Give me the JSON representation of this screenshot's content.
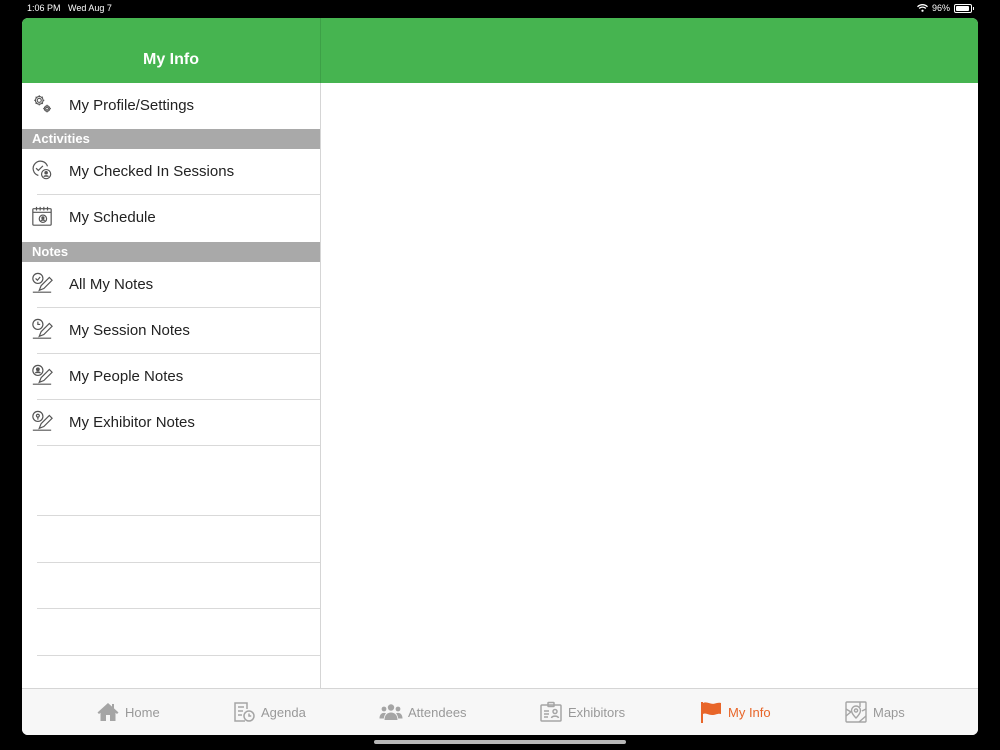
{
  "status": {
    "time": "1:06 PM",
    "date": "Wed Aug 7",
    "battery": "96%",
    "battery_level": 0.96
  },
  "header": {
    "title": "My Info"
  },
  "sidebar": {
    "profile": {
      "label": "My Profile/Settings",
      "icon": "gears-icon"
    },
    "sections": [
      {
        "title": "Activities",
        "items": [
          {
            "label": "My Checked In Sessions",
            "icon": "checked-in-icon"
          },
          {
            "label": "My Schedule",
            "icon": "calendar-icon"
          }
        ]
      },
      {
        "title": "Notes",
        "items": [
          {
            "label": "All My Notes",
            "icon": "notes-check-icon"
          },
          {
            "label": "My Session Notes",
            "icon": "notes-clock-icon"
          },
          {
            "label": "My People Notes",
            "icon": "notes-person-icon"
          },
          {
            "label": "My Exhibitor Notes",
            "icon": "notes-pin-icon"
          }
        ]
      }
    ]
  },
  "tabs": [
    {
      "label": "Home",
      "icon": "home-icon",
      "active": false
    },
    {
      "label": "Agenda",
      "icon": "agenda-icon",
      "active": false
    },
    {
      "label": "Attendees",
      "icon": "attendees-icon",
      "active": false
    },
    {
      "label": "Exhibitors",
      "icon": "exhibitors-icon",
      "active": false
    },
    {
      "label": "My Info",
      "icon": "flag-icon",
      "active": true
    },
    {
      "label": "Maps",
      "icon": "maps-icon",
      "active": false
    }
  ],
  "colors": {
    "header": "#46b450",
    "accent": "#e8662a",
    "section": "#a9a9a9",
    "tab_inactive": "#999999"
  }
}
